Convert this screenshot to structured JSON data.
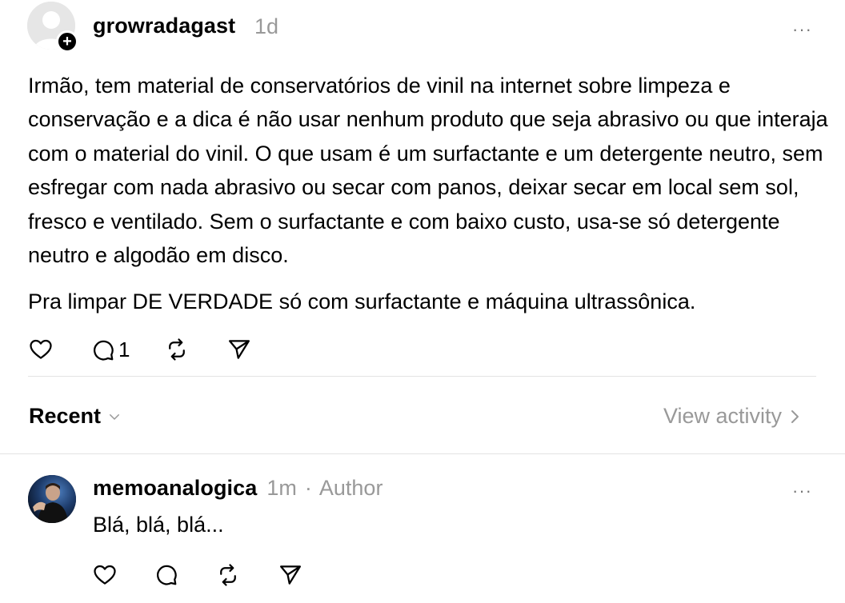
{
  "post": {
    "username": "growradagast",
    "time": "1d",
    "paragraphs": [
      "Irmão, tem material de conservatórios de vinil na internet sobre limpeza e conservação e a dica é não usar nenhum produto que seja abrasivo ou que interaja com o material do vinil. O que usam é um surfactante e um detergente neutro, sem esfregar com nada abrasivo ou secar com panos, deixar secar em local sem sol, fresco e ventilado. Sem o surfactante e com baixo custo, usa-se só detergente neutro e algodão em disco.",
      "Pra limpar DE VERDADE só com surfactante e máquina ultrassônica."
    ],
    "reply_count": "1",
    "follow_symbol": "+",
    "more_symbol": "···"
  },
  "activity": {
    "sort_label": "Recent",
    "view_activity_label": "View activity"
  },
  "reply": {
    "username": "memoanalogica",
    "time": "1m",
    "separator": "·",
    "author_tag": "Author",
    "text": "Blá, blá, blá...",
    "more_symbol": "···"
  },
  "icons": {
    "like": "heart-icon",
    "reply": "comment-icon",
    "repost": "repost-icon",
    "share": "send-icon",
    "more": "more-icon",
    "chevron_down": "chevron-down-icon",
    "chevron_right": "chevron-right-icon"
  }
}
